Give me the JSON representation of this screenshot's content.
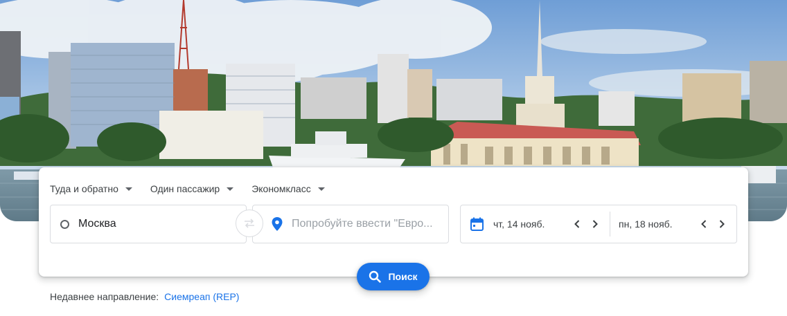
{
  "options": {
    "trip_type": "Туда и обратно",
    "passengers": "Один пассажир",
    "cabin_class": "Экономкласс"
  },
  "search": {
    "from_value": "Москва",
    "to_placeholder": "Попробуйте ввести \"Евро...",
    "depart_date": "чт, 14 нояб.",
    "return_date": "пн, 18 нояб.",
    "button_label": "Поиск"
  },
  "recent": {
    "label": "Недавнее направление:",
    "destination": "Сиемреап (REP)"
  },
  "colors": {
    "accent": "#1a73e8",
    "text": "#3c4043",
    "placeholder": "#9aa0a6",
    "border": "#dadce0"
  },
  "icons": [
    "chevron-down-icon",
    "origin-ring-icon",
    "swap-icon",
    "location-pin-icon",
    "calendar-icon",
    "chevron-left-icon",
    "chevron-right-icon",
    "search-icon"
  ]
}
